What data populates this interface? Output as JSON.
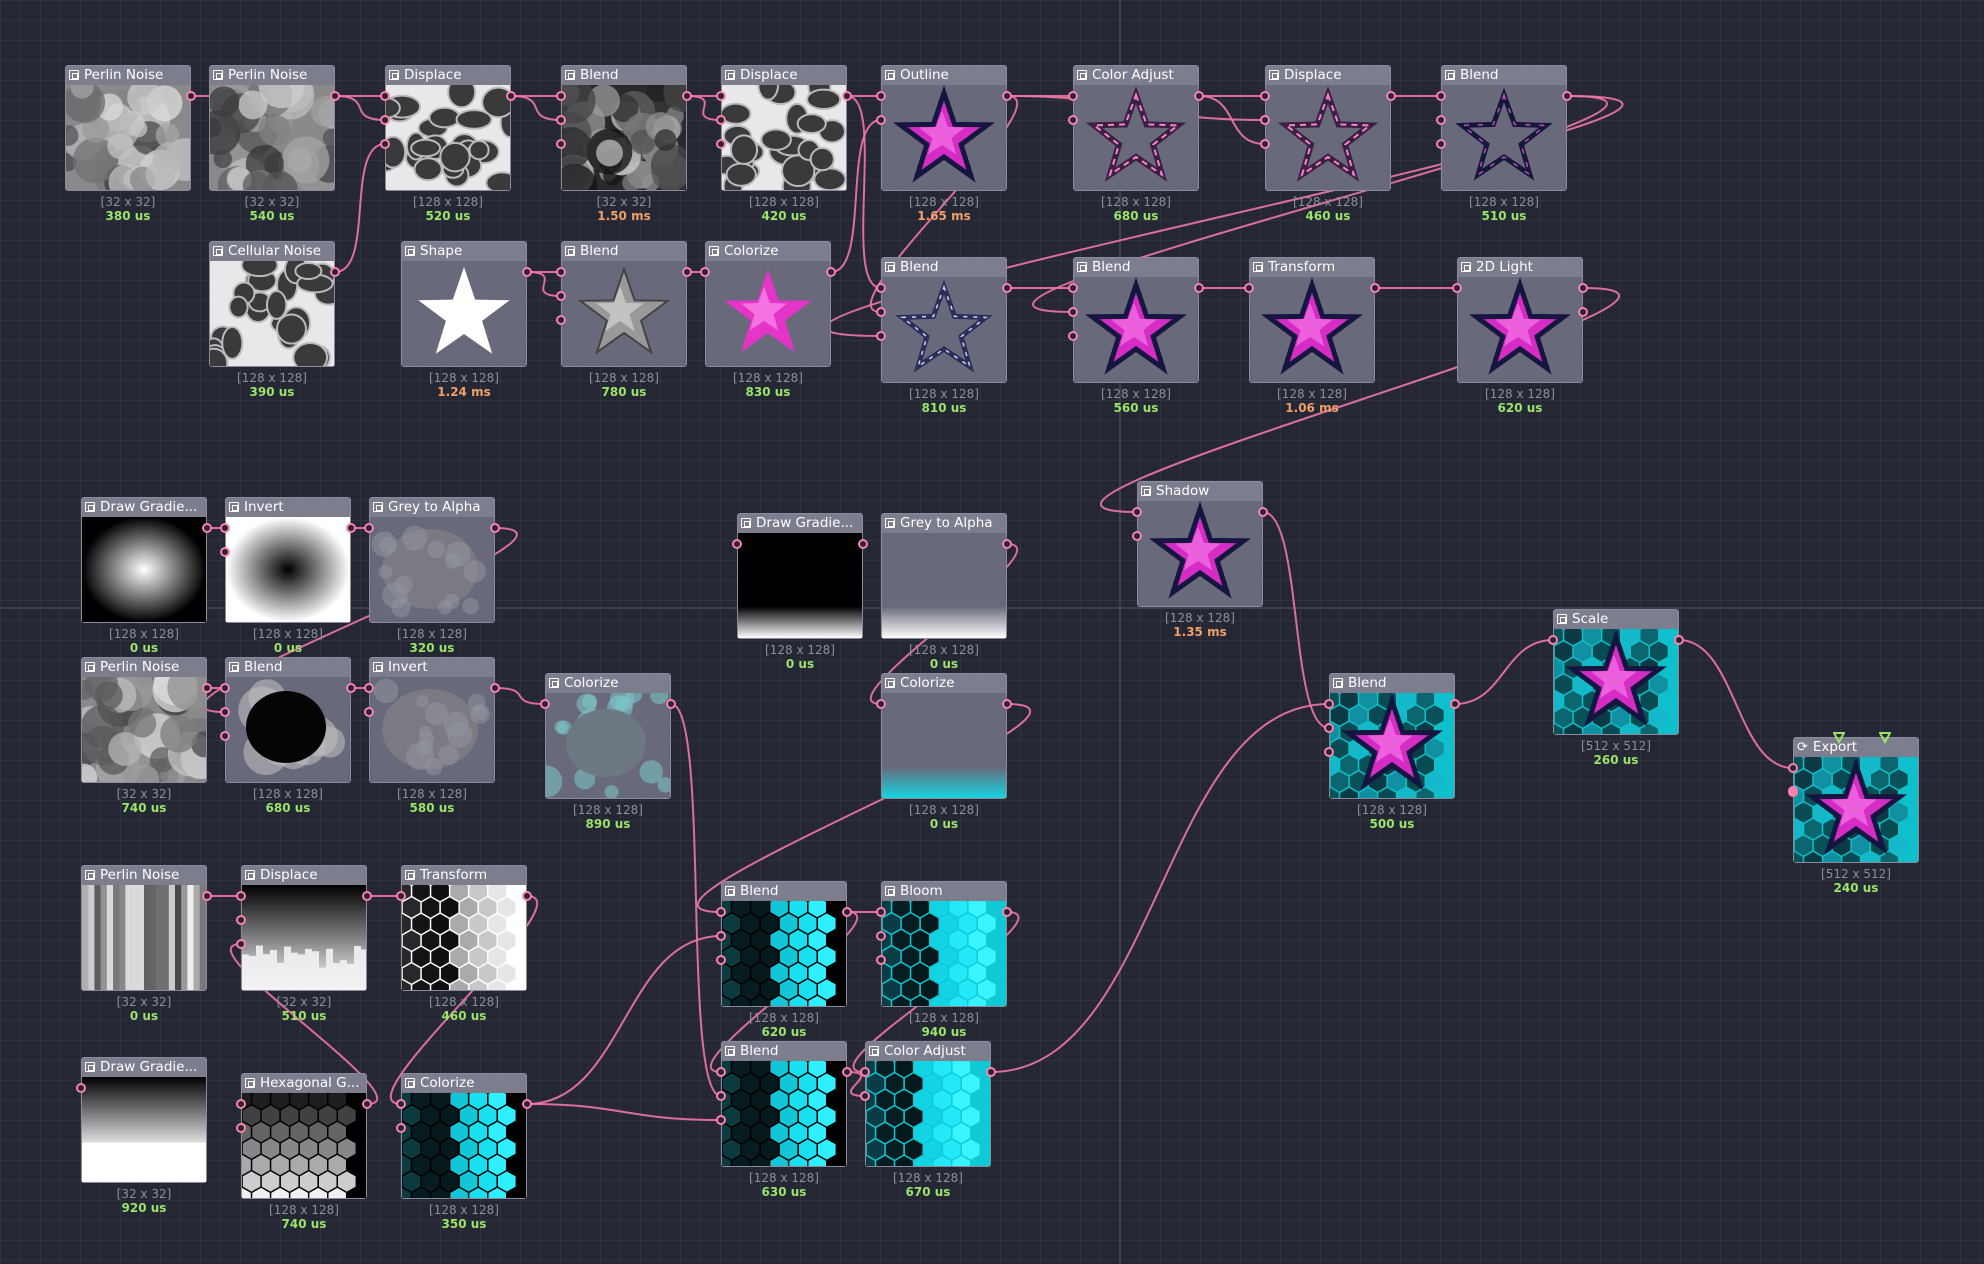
{
  "colors": {
    "background": "#262734",
    "wire": "#ef78a4",
    "port": "#ff7fae",
    "time_fast": "#9be36a",
    "time_slow": "#f0a066"
  },
  "nodes": {
    "perlin_noise_1": {
      "title": "Perlin Noise",
      "size": "[32 x 32]",
      "time": "380 us",
      "preview": "noise-grey"
    },
    "perlin_noise_2": {
      "title": "Perlin Noise",
      "size": "[32 x 32]",
      "time": "540 us",
      "preview": "noise-grey"
    },
    "displace_1": {
      "title": "Displace",
      "size": "[128 x 128]",
      "time": "520 us",
      "preview": "cells-grey"
    },
    "blend_1": {
      "title": "Blend",
      "size": "[32 x 32]",
      "time": "1.50 ms",
      "preview": "dark-grey"
    },
    "displace_2": {
      "title": "Displace",
      "size": "[128 x 128]",
      "time": "420 us",
      "preview": "cells-grey"
    },
    "outline": {
      "title": "Outline",
      "size": "[128 x 128]",
      "time": "1.65 ms",
      "preview": "star-magenta-outlined"
    },
    "color_adjust_1": {
      "title": "Color Adjust",
      "size": "[128 x 128]",
      "time": "680 us",
      "preview": "star-outline-pink"
    },
    "displace_3": {
      "title": "Displace",
      "size": "[128 x 128]",
      "time": "460 us",
      "preview": "star-outline-pink"
    },
    "blend_2": {
      "title": "Blend",
      "size": "[128 x 128]",
      "time": "510 us",
      "preview": "star-outline-navy"
    },
    "cellular_noise": {
      "title": "Cellular Noise",
      "size": "[128 x 128]",
      "time": "390 us",
      "preview": "cells-grey"
    },
    "shape": {
      "title": "Shape",
      "size": "[128 x 128]",
      "time": "1.24 ms",
      "preview": "star-white"
    },
    "blend_3": {
      "title": "Blend",
      "size": "[128 x 128]",
      "time": "780 us",
      "preview": "star-grey"
    },
    "colorize_1": {
      "title": "Colorize",
      "size": "[128 x 128]",
      "time": "830 us",
      "preview": "star-magenta"
    },
    "blend_4": {
      "title": "Blend",
      "size": "[128 x 128]",
      "time": "810 us",
      "preview": "star-outline-blue"
    },
    "blend_5": {
      "title": "Blend",
      "size": "[128 x 128]",
      "time": "560 us",
      "preview": "star-magenta-outlined"
    },
    "transform_1": {
      "title": "Transform",
      "size": "[128 x 128]",
      "time": "1.06 ms",
      "preview": "star-magenta-outlined"
    },
    "light_2d": {
      "title": "2D Light",
      "size": "[128 x 128]",
      "time": "620 us",
      "preview": "star-magenta-outlined"
    },
    "shadow": {
      "title": "Shadow",
      "size": "[128 x 128]",
      "time": "1.35 ms",
      "preview": "star-magenta-outlined"
    },
    "draw_gradient_1": {
      "title": "Draw Gradie...",
      "size": "[128 x 128]",
      "time": "0 us",
      "preview": "radial-white"
    },
    "invert_1": {
      "title": "Invert",
      "size": "[128 x 128]",
      "time": "0 us",
      "preview": "radial-black"
    },
    "grey_to_alpha_1": {
      "title": "Grey to Alpha",
      "size": "[128 x 128]",
      "time": "320 us",
      "preview": "blob-grey"
    },
    "perlin_noise_3": {
      "title": "Perlin Noise",
      "size": "[32 x 32]",
      "time": "740 us",
      "preview": "noise-grey"
    },
    "blend_6": {
      "title": "Blend",
      "size": "[128 x 128]",
      "time": "680 us",
      "preview": "blob-black"
    },
    "invert_2": {
      "title": "Invert",
      "size": "[128 x 128]",
      "time": "580 us",
      "preview": "blob-grey"
    },
    "colorize_2": {
      "title": "Colorize",
      "size": "[128 x 128]",
      "time": "890 us",
      "preview": "blob-teal"
    },
    "draw_gradient_2": {
      "title": "Draw Gradie...",
      "size": "[128 x 128]",
      "time": "0 us",
      "preview": "bottom-fade-black"
    },
    "grey_to_alpha_2": {
      "title": "Grey to Alpha",
      "size": "[128 x 128]",
      "time": "0 us",
      "preview": "bottom-fade-grey"
    },
    "colorize_3": {
      "title": "Colorize",
      "size": "[128 x 128]",
      "time": "0 us",
      "preview": "bottom-fade-cyan"
    },
    "perlin_noise_4": {
      "title": "Perlin Noise",
      "size": "[32 x 32]",
      "time": "0 us",
      "preview": "stripes-grey"
    },
    "displace_4": {
      "title": "Displace",
      "size": "[32 x 32]",
      "time": "510 us",
      "preview": "bars-grey"
    },
    "transform_2": {
      "title": "Transform",
      "size": "[128 x 128]",
      "time": "460 us",
      "preview": "hex-grey"
    },
    "draw_gradient_3": {
      "title": "Draw Gradie...",
      "size": "[32 x 32]",
      "time": "920 us",
      "preview": "vertical-gradient"
    },
    "hexagonal_g": {
      "title": "Hexagonal G...",
      "size": "[128 x 128]",
      "time": "740 us",
      "preview": "hex-mono"
    },
    "colorize_4": {
      "title": "Colorize",
      "size": "[128 x 128]",
      "time": "350 us",
      "preview": "hex-cyan"
    },
    "blend_7": {
      "title": "Blend",
      "size": "[128 x 128]",
      "time": "620 us",
      "preview": "hex-cyan"
    },
    "bloom": {
      "title": "Bloom",
      "size": "[128 x 128]",
      "time": "940 us",
      "preview": "hex-cyan-bright"
    },
    "blend_8": {
      "title": "Blend",
      "size": "[128 x 128]",
      "time": "630 us",
      "preview": "hex-cyan"
    },
    "color_adjust_2": {
      "title": "Color Adjust",
      "size": "[128 x 128]",
      "time": "670 us",
      "preview": "hex-cyan-bright"
    },
    "blend_9": {
      "title": "Blend",
      "size": "[128 x 128]",
      "time": "500 us",
      "preview": "star-on-hex"
    },
    "scale": {
      "title": "Scale",
      "size": "[512 x 512]",
      "time": "260 us",
      "preview": "star-on-hex"
    },
    "export": {
      "title": "Export",
      "size": "[512 x 512]",
      "time": "240 us",
      "preview": "star-on-hex"
    }
  }
}
